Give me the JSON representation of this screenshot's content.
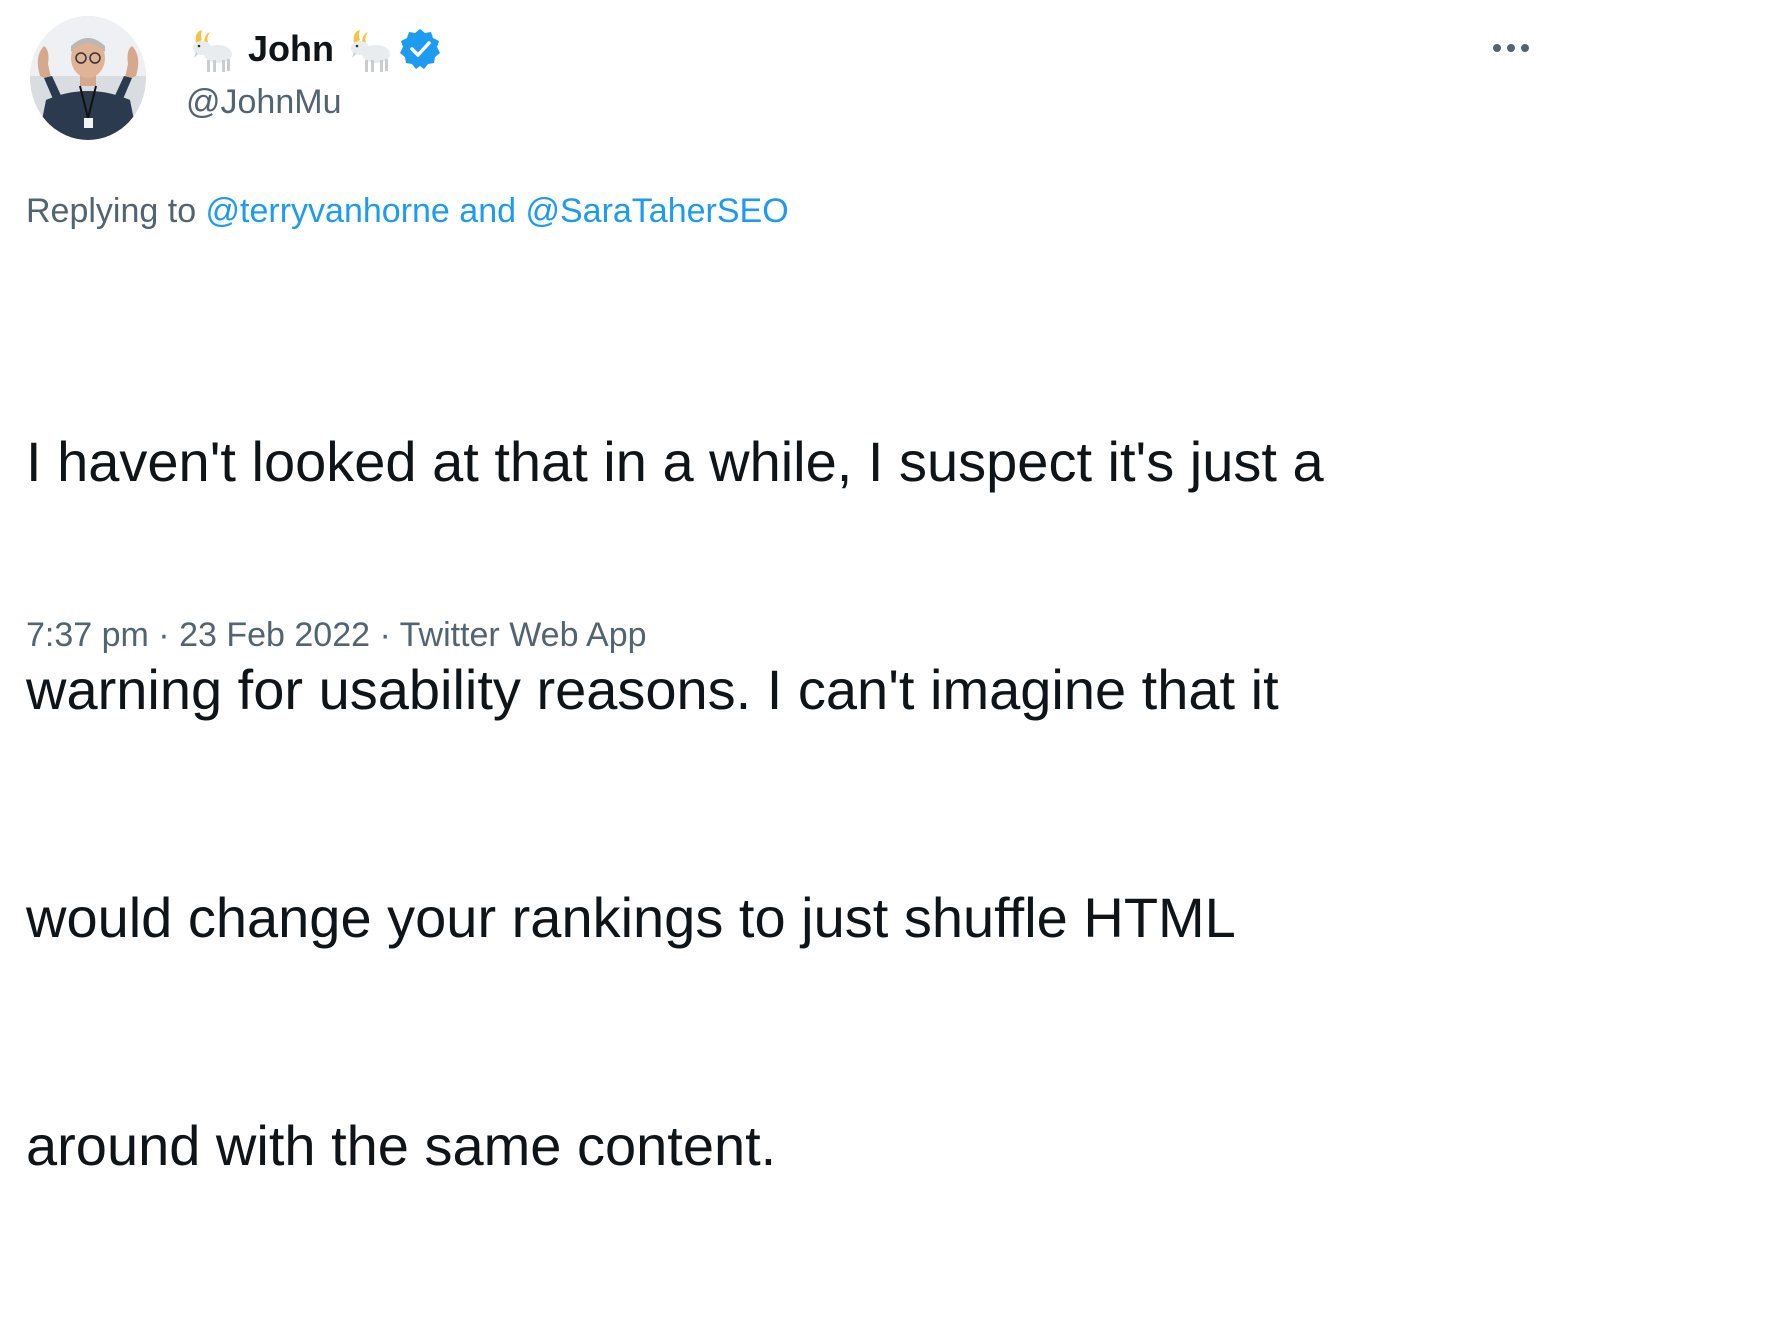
{
  "author": {
    "display_name": "John",
    "handle": "@JohnMu",
    "name_prefix_emoji": "goat-emoji",
    "name_suffix_emoji": "goat-emoji",
    "verified_icon": "verified-badge-icon"
  },
  "reply_context": {
    "prefix": "Replying to ",
    "mention_1": "@terryvanhorne",
    "joiner": " and ",
    "mention_2": "@SaraTaherSEO"
  },
  "tweet": {
    "text_lines": [
      "I haven't looked at that in a while, I suspect it's just a",
      "warning for usability reasons. I can't imagine that it",
      "would change your rankings to just shuffle HTML",
      "around with the same content."
    ]
  },
  "meta": {
    "time": "7:37 pm",
    "separator": " · ",
    "date": "23 Feb 2022",
    "source": "Twitter Web App"
  },
  "colors": {
    "accent": "#1d9bf0",
    "secondary_text": "#536471",
    "primary_text": "#0f1419"
  },
  "icons": {
    "more": "more-options-icon"
  }
}
